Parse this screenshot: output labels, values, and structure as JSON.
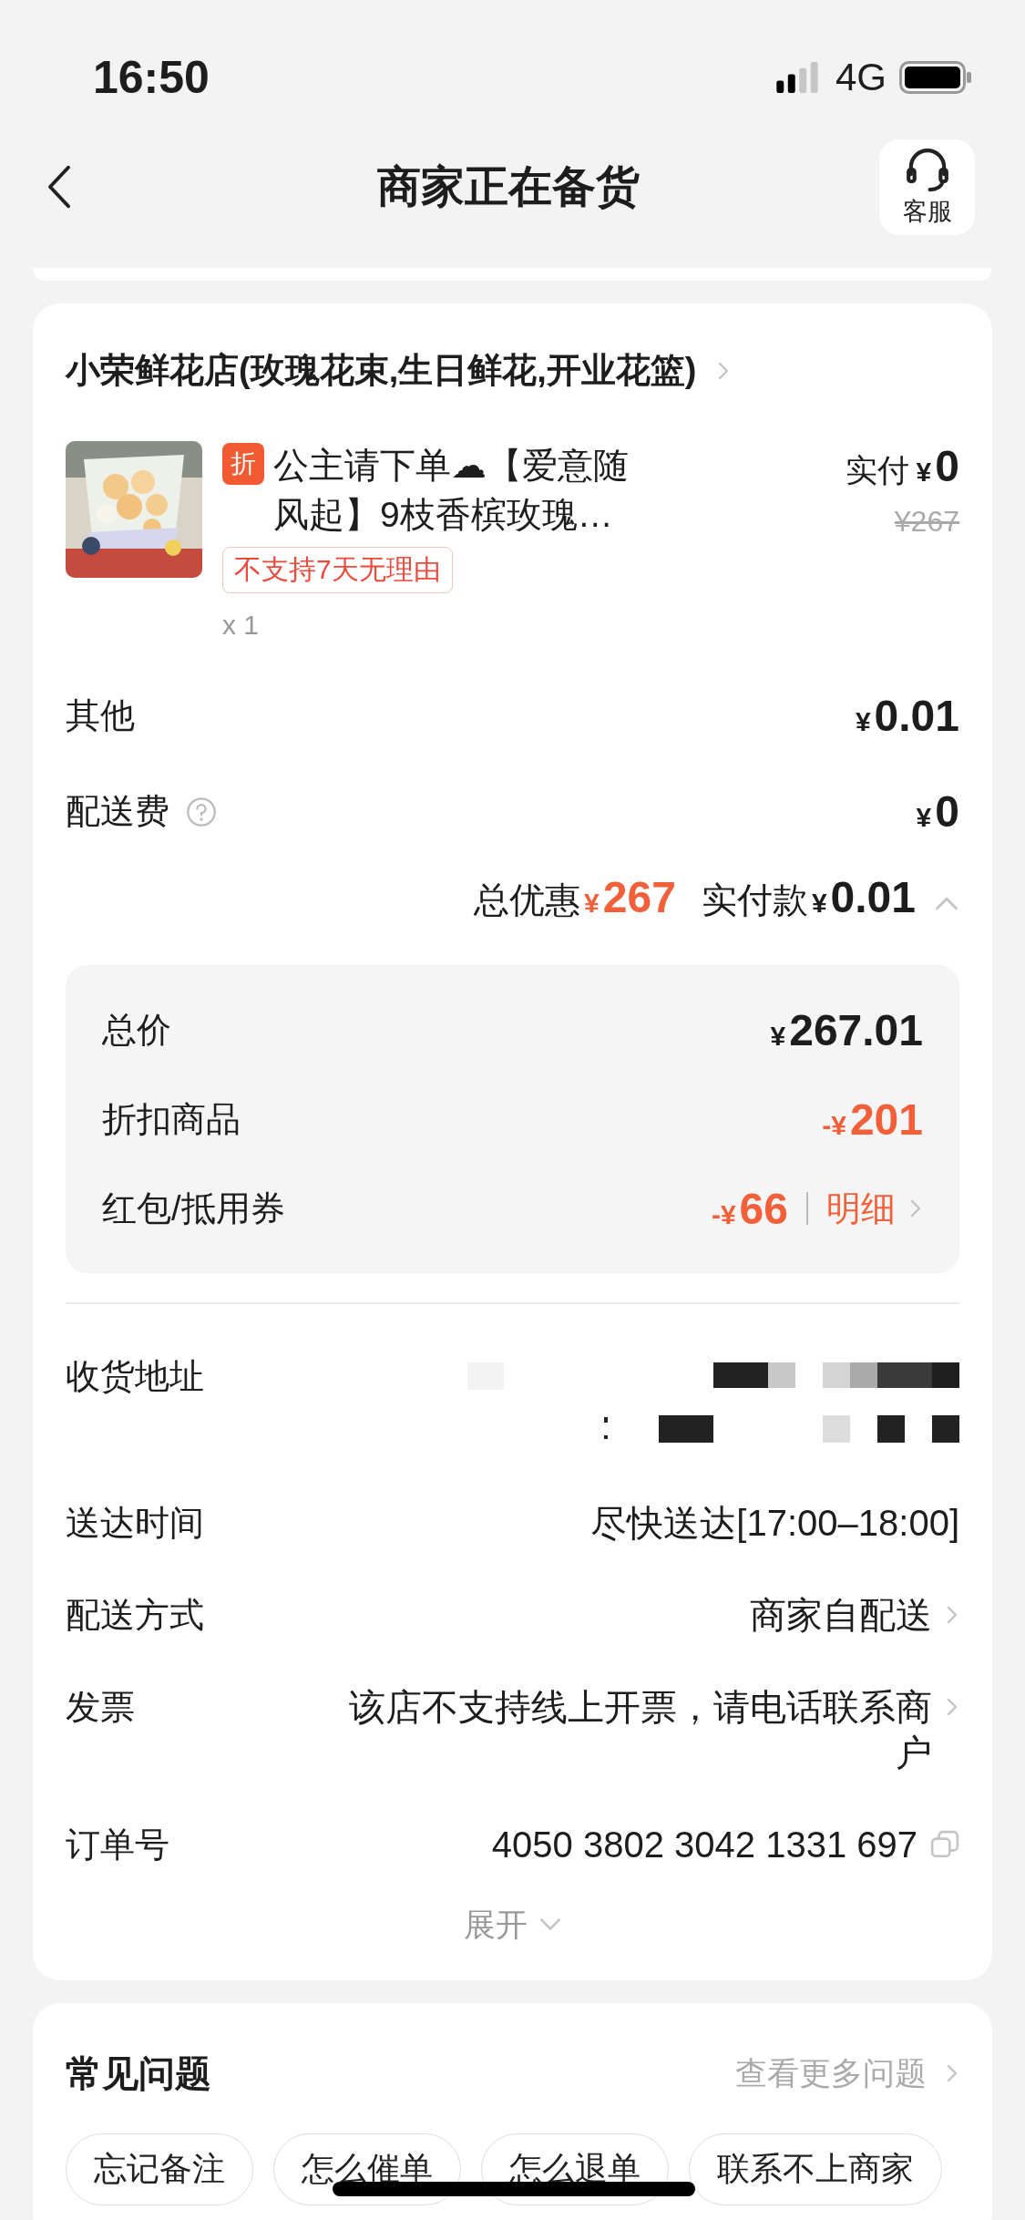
{
  "status_bar": {
    "time": "16:50",
    "network": "4G"
  },
  "nav": {
    "title": "商家正在备货",
    "service_label": "客服"
  },
  "shop": {
    "name": "小荣鲜花店(玫瑰花束,生日鲜花,开业花篮)"
  },
  "product": {
    "kind": "picture",
    "discount_tag": "折",
    "title": "公主请下单☁【爱意随风起】9枝香槟玫瑰…",
    "badge": "不支持7天无理由",
    "quantity": "x 1",
    "paid_label": "实付",
    "paid_currency": "¥",
    "paid_amount": "0",
    "original_price": "¥267"
  },
  "fees": [
    {
      "label": "其他",
      "help": false,
      "currency": "¥",
      "amount": "0.01"
    },
    {
      "label": "配送费",
      "help": true,
      "currency": "¥",
      "amount": "0"
    }
  ],
  "summary": {
    "discount_label": "总优惠",
    "discount_currency": "¥",
    "discount_amount": "267",
    "paid_label": "实付款",
    "paid_currency": "¥",
    "paid_amount": "0.01",
    "expanded": true
  },
  "breakdown": [
    {
      "kind": "total",
      "label": "总价",
      "currency": "¥",
      "amount": "267.01"
    },
    {
      "kind": "deduction",
      "label": "折扣商品",
      "currency": "-¥",
      "amount": "201"
    },
    {
      "kind": "deduction",
      "label": "红包/抵用券",
      "currency": "-¥",
      "amount": "66",
      "link": "明细"
    }
  ],
  "details": [
    {
      "kind": "redacted",
      "label": "收货地址"
    },
    {
      "kind": "text",
      "label": "送达时间",
      "value": "尽快送达[17:00–18:00]"
    },
    {
      "kind": "link",
      "label": "配送方式",
      "value": "商家自配送"
    },
    {
      "kind": "link",
      "label": "发票",
      "value": "该店不支持线上开票，请电话联系商户"
    },
    {
      "kind": "copy",
      "label": "订单号",
      "value": "4050 3802 3042 1331 697"
    }
  ],
  "expand_label": "展开",
  "faq": {
    "title": "常见问题",
    "more": "查看更多问题",
    "chips": [
      "忘记备注",
      "怎么催单",
      "怎么退单",
      "联系不上商家"
    ]
  }
}
